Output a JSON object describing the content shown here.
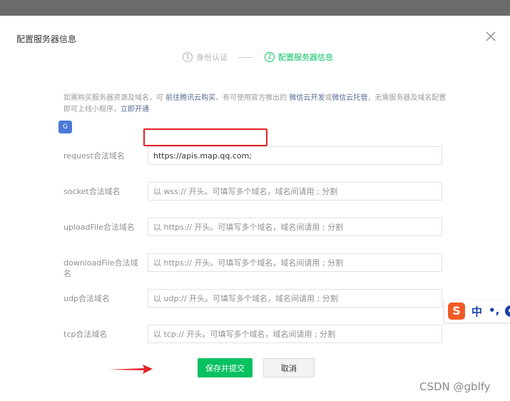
{
  "dialog": {
    "title": "配置服务器信息"
  },
  "steps": [
    {
      "num": "1",
      "label": "身份认证",
      "state": "done"
    },
    {
      "num": "2",
      "label": "配置服务器信息",
      "state": "active"
    }
  ],
  "description": {
    "part1": "如需购买服务器资源及域名，可 ",
    "link1": "前往腾讯云购买",
    "part2": "。有可使用官方推出的 ",
    "link2": "微信云开发",
    "part3": "或",
    "link3": "微信云托管",
    "part4": "，无需服务器及域名配置即可上线小程序，",
    "link4": "立即开通"
  },
  "form": {
    "request": {
      "label": "request合法域名",
      "value": "https://apis.map.qq.com;",
      "placeholder": ""
    },
    "socket": {
      "label": "socket合法域名",
      "value": "",
      "placeholder": "以 wss:// 开头。可填写多个域名，域名间请用 ; 分割"
    },
    "uploadFile": {
      "label": "uploadFile合法域名",
      "value": "",
      "placeholder": "以 https:// 开头。可填写多个域名，域名间请用 ; 分割"
    },
    "downloadFile": {
      "label": "downloadFile合法域名",
      "value": "",
      "placeholder": "以 https:// 开头。可填写多个域名，域名间请用 ; 分割"
    },
    "udp": {
      "label": "udp合法域名",
      "value": "",
      "placeholder": "以 udp:// 开头。可填写多个域名，域名间请用 ; 分割"
    },
    "tcp": {
      "label": "tcp合法域名",
      "value": "",
      "placeholder": "以 tcp:// 开头。可填写多个域名，域名间请用 ; 分割"
    }
  },
  "buttons": {
    "save": "保存并提交",
    "cancel": "取消"
  },
  "ime_toolbar": {
    "logo": "S",
    "mode": "中",
    "punct": "•,",
    "extra": "e"
  },
  "watermark": "CSDN @gblfy",
  "colors": {
    "accent": "#07c160",
    "link": "#576b95",
    "highlight": "#e32227"
  }
}
